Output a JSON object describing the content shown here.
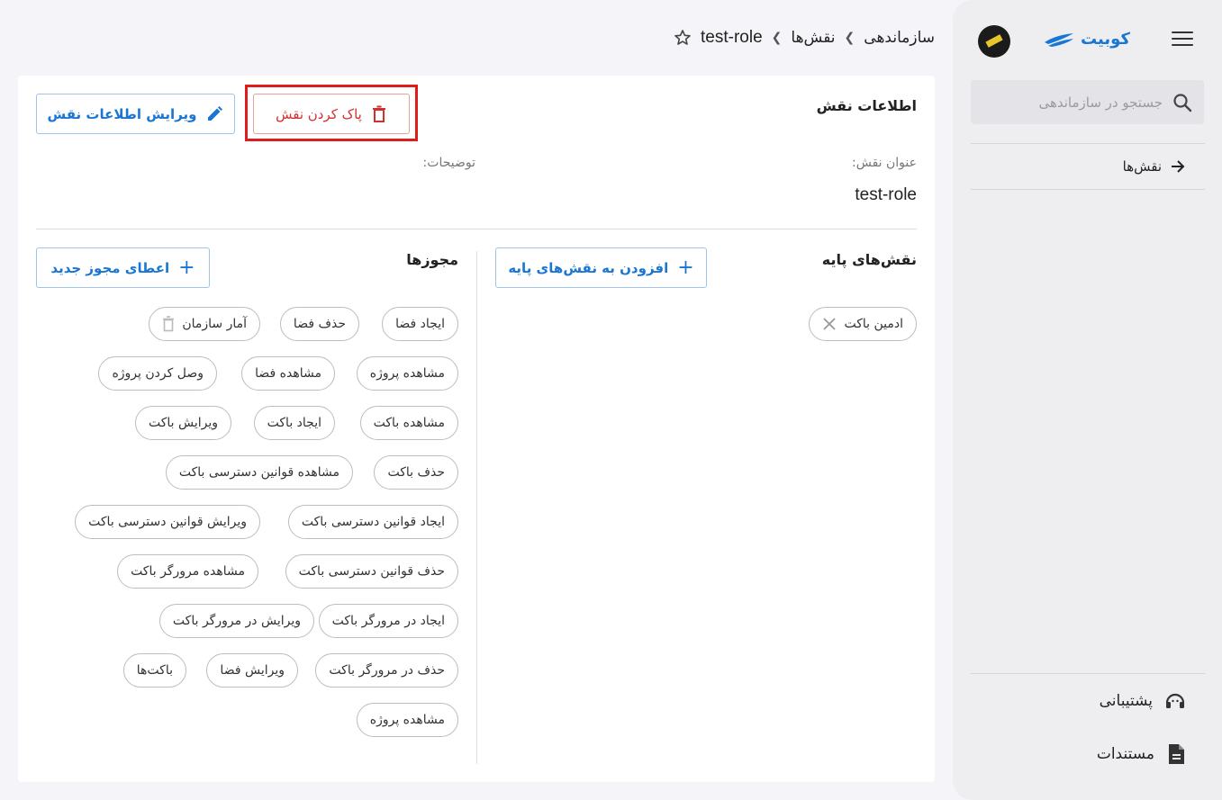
{
  "sidebar": {
    "brand_name": "کوبیت",
    "search_placeholder": "جستجو در سازماندهی",
    "nav_roles": "نقش‌ها",
    "support": "پشتیبانی",
    "docs": "مستندات"
  },
  "breadcrumb": {
    "org": "سازماندهی",
    "roles": "نقش‌ها",
    "current": "test-role"
  },
  "role_info": {
    "title": "اطلاعات نقش",
    "delete_label": "پاک کردن نقش",
    "edit_label": "ویرایش اطلاعات نقش",
    "title_label": "عنوان نقش:",
    "title_value": "test-role",
    "desc_label": "توضیحات:"
  },
  "base_roles": {
    "title": "نقش‌های پایه",
    "add_label": "افزودن به نقش‌های پایه",
    "items": [
      "ادمین باکت"
    ]
  },
  "permissions": {
    "title": "مجوزها",
    "add_label": "اعطای مجوز جدید",
    "items": [
      "ایجاد فضا",
      "حذف فضا",
      "آمار سازمان",
      "مشاهده پروژه",
      "مشاهده فضا",
      "وصل کردن پروژه",
      "مشاهده باکت",
      "ایجاد باکت",
      "ویرایش باکت",
      "حذف باکت",
      "مشاهده قوانین دسترسی باکت",
      "ایجاد قوانین دسترسی باکت",
      "ویرایش قوانین دسترسی باکت",
      "حذف قوانین دسترسی باکت",
      "مشاهده مرورگر باکت",
      "ایجاد در مرورگر باکت",
      "ویرایش در مرورگر باکت",
      "حذف در مرورگر باکت",
      "ویرایش فضا",
      "باکت‌ها",
      "مشاهده پروژه"
    ]
  },
  "colors": {
    "accent": "#1976d2",
    "danger": "#d32f2f",
    "highlight": "#e01b1b"
  }
}
